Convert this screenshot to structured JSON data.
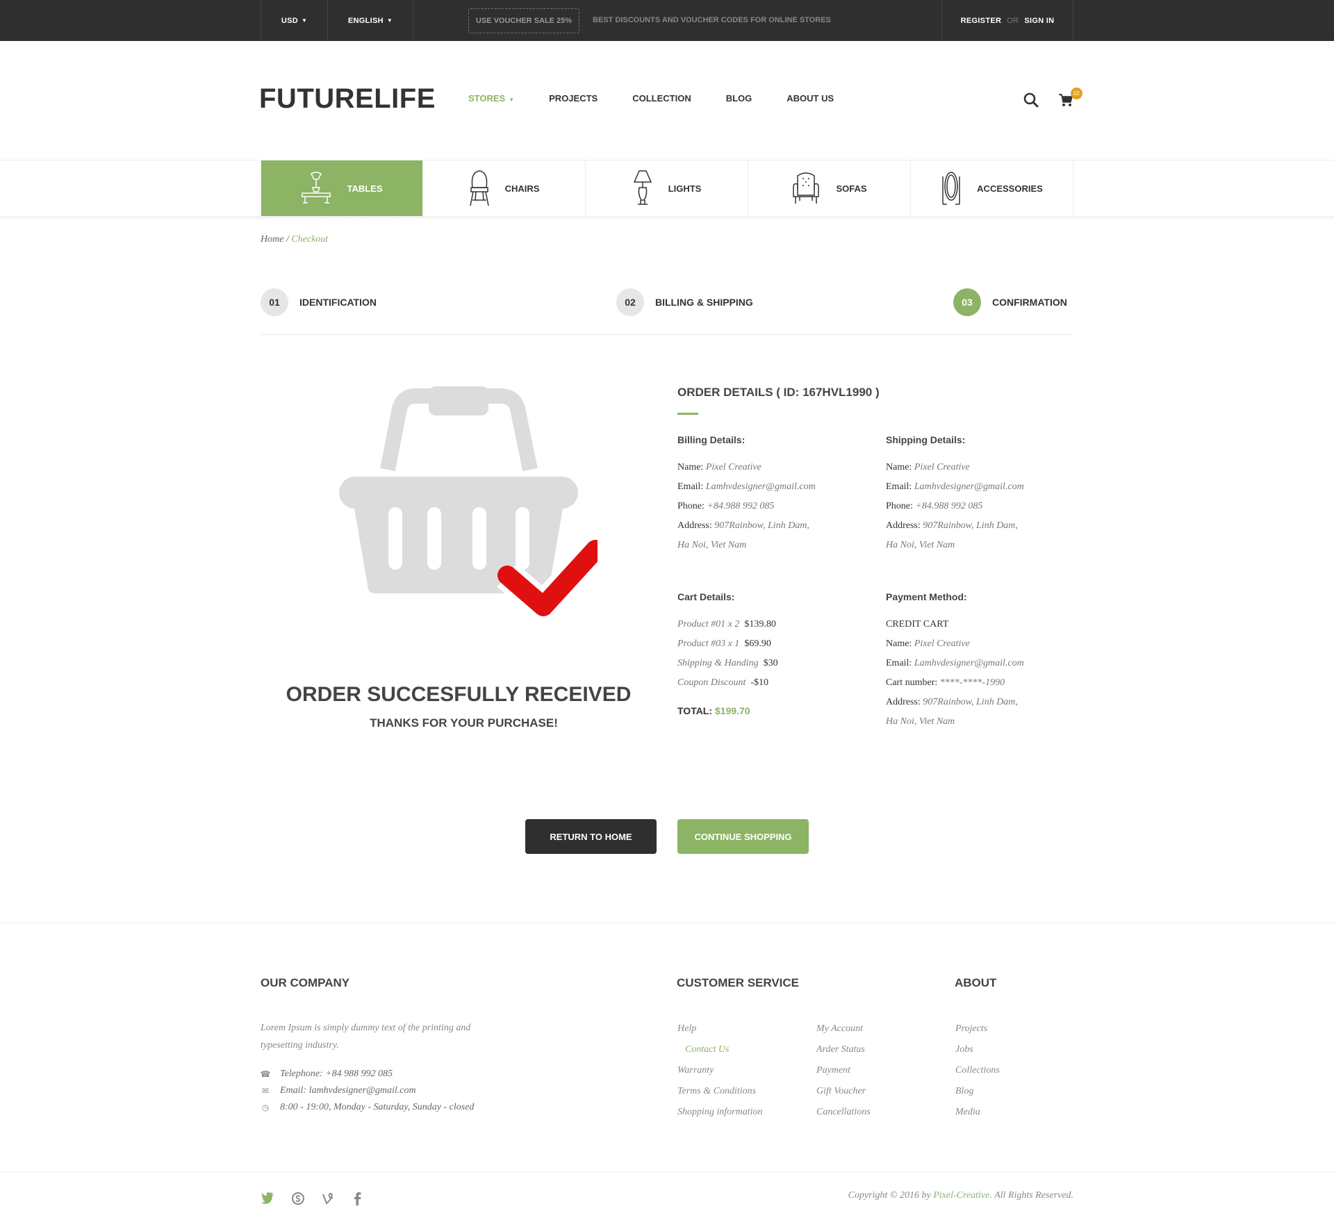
{
  "topbar": {
    "currency": "USD",
    "language": "ENGLISH",
    "voucher": "USE VOUCHER SALE 25%",
    "message": "BEST DISCOUNTS AND VOUCHER CODES FOR ONLINE STORES",
    "register": "REGISTER",
    "or": "OR",
    "signin": "SIGN IN"
  },
  "header": {
    "logo": "FUTURELIFE",
    "nav": [
      "STORES",
      "PROJECTS",
      "COLLECTION",
      "BLOG",
      "ABOUT US"
    ],
    "cart_count": "02",
    "icons": [
      "search-icon",
      "cart-icon"
    ]
  },
  "categories": [
    "TABLES",
    "CHAIRS",
    "LIGHTS",
    "SOFAS",
    "ACCESSORIES"
  ],
  "breadcrumb": {
    "home": "Home",
    "sep": "/",
    "current": "Checkout"
  },
  "steps": [
    {
      "num": "01",
      "label": "IDENTIFICATION"
    },
    {
      "num": "02",
      "label": "BILLING & SHIPPING"
    },
    {
      "num": "03",
      "label": "CONFIRMATION"
    }
  ],
  "success": {
    "title": "ORDER SUCCESFULLY RECEIVED",
    "subtitle": "THANKS FOR YOUR PURCHASE!"
  },
  "order": {
    "title": "ORDER DETAILS ( ID: 167HVL1990 )",
    "billing": {
      "heading": "Billing Details:",
      "name_label": "Name:",
      "name": "Pixel Creative",
      "email_label": "Email:",
      "email": "Lamhvdesigner@gmail.com",
      "phone_label": "Phone:",
      "phone": "+84.988 992 085",
      "address_label": "Address:",
      "address1": "907Rainbow, Linh Dam,",
      "address2": "Ha Noi, Viet Nam"
    },
    "shipping": {
      "heading": "Shipping Details:",
      "name_label": "Name:",
      "name": "Pixel Creative",
      "email_label": "Email:",
      "email": "Lamhvdesigner@gmail.com",
      "phone_label": "Phone:",
      "phone": "+84.988 992 085",
      "address_label": "Address:",
      "address1": "907Rainbow, Linh Dam,",
      "address2": "Ha Noi, Viet Nam"
    },
    "cart": {
      "heading": "Cart Details:",
      "items": [
        {
          "label": "Product #01 x 2",
          "price": "$139.80"
        },
        {
          "label": "Product #03 x 1",
          "price": "$69.90"
        },
        {
          "label": "Shipping & Handing",
          "price": "$30"
        },
        {
          "label": "Coupon Discount",
          "price": "-$10"
        }
      ],
      "total_label": "TOTAL:",
      "total": "$199.70"
    },
    "payment": {
      "heading": "Payment Method:",
      "method": "CREDIT CART",
      "name_label": "Name:",
      "name": "Pixel Creative",
      "email_label": "Email:",
      "email": "Lamhvdesigner@gmail.com",
      "card_label": "Cart number:",
      "card": "****-****-1990",
      "address_label": "Address:",
      "address1": "907Rainbow, Linh Dam,",
      "address2": "Ha Noi, Viet Nam"
    }
  },
  "buttons": {
    "home": "RETURN TO HOME",
    "continue": "CONTINUE SHOPPING"
  },
  "footer": {
    "company_heading": "OUR COMPANY",
    "company_text": "Lorem Ipsum is simply dummy text of the printing and typesetting industry.",
    "telephone": "Telephone: +84 988 992 085",
    "email": "Email: lamhvdesigner@gmail.com",
    "hours": "8:00 - 19:00, Monday - Saturday, Sunday - closed",
    "service_heading": "CUSTOMER SERVICE",
    "service_col1": [
      "Help",
      "Contact Us",
      "Warranty",
      "Terms & Conditions",
      "Shopping information"
    ],
    "service_col2": [
      "My Account",
      "Arder Status",
      "Payment",
      "Gift Voucher",
      "Cancellations"
    ],
    "about_heading": "ABOUT",
    "about_links": [
      "Projects",
      "Jobs",
      "Collections",
      "Blog",
      "Media"
    ],
    "social": [
      "twitter-icon",
      "skype-icon",
      "vine-icon",
      "facebook-icon"
    ],
    "copyright_pre": "Copyright © 2016 by",
    "copyright_brand": "Pixel-Creative",
    "copyright_post": ". All Rights Reserved."
  },
  "colors": {
    "accent": "#8cb464",
    "dark": "#2f2f2f",
    "check": "#e01010",
    "badge": "#e0a020"
  }
}
